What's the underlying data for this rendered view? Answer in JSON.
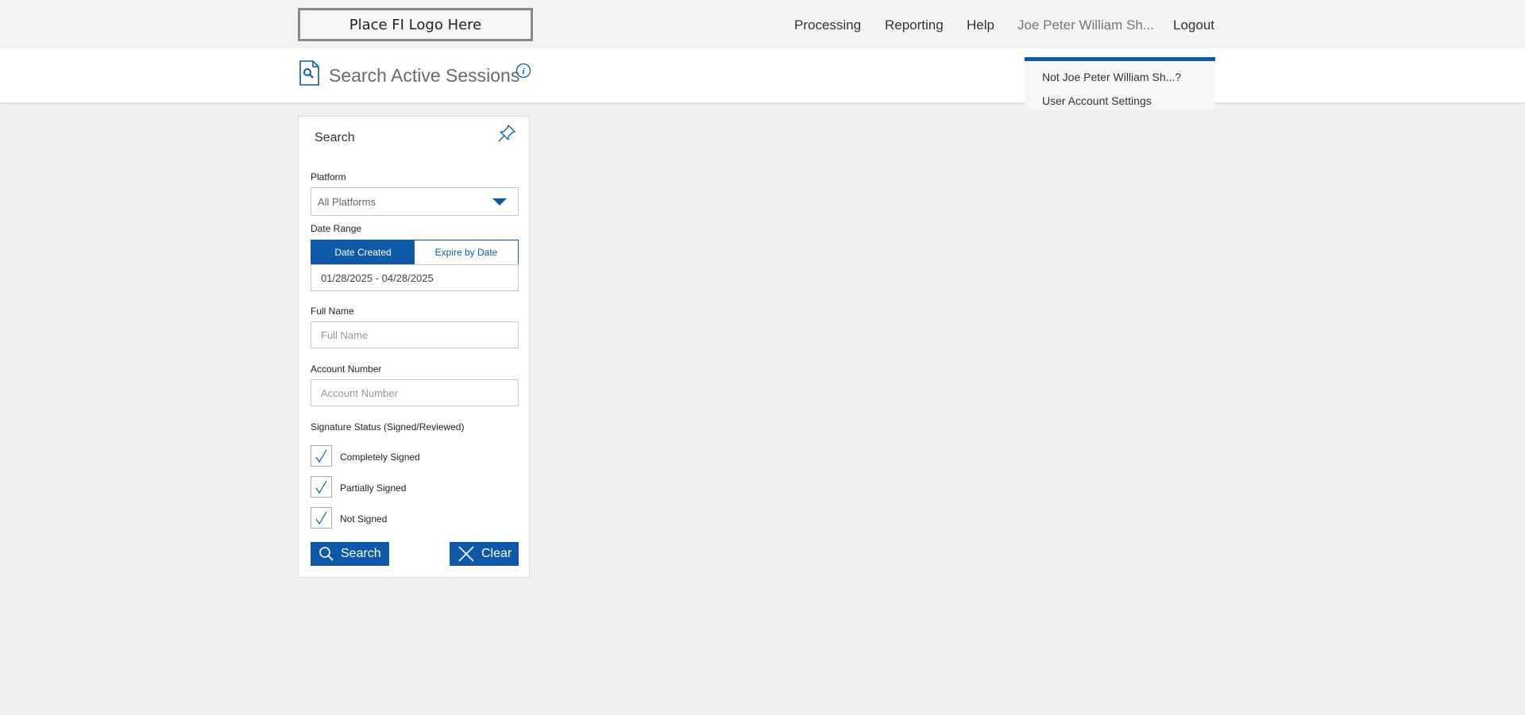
{
  "header": {
    "logo_text": "Place FI Logo Here",
    "nav": {
      "processing": "Processing",
      "reporting": "Reporting",
      "help": "Help",
      "user": "Joe Peter William Sh...",
      "logout": "Logout"
    }
  },
  "page": {
    "title": "Search Active Sessions",
    "title_icon": "search-document-icon",
    "info_icon": "info-icon"
  },
  "user_menu": {
    "items": [
      "Not Joe Peter William Sh...?",
      "User Account Settings"
    ]
  },
  "search_panel": {
    "title": "Search",
    "pin_icon": "pin-icon",
    "platform": {
      "label": "Platform",
      "selected": "All Platforms"
    },
    "date_range": {
      "label": "Date Range",
      "options": [
        "Date Created",
        "Expire by Date"
      ],
      "selected": "Date Created",
      "value": "01/28/2025 - 04/28/2025"
    },
    "full_name": {
      "label": "Full Name",
      "placeholder": "Full Name"
    },
    "account_number": {
      "label": "Account Number",
      "placeholder": "Account Number"
    },
    "signature_status": {
      "label": "Signature Status (Signed/Reviewed)",
      "options": [
        {
          "label": "Completely Signed",
          "checked": true
        },
        {
          "label": "Partially Signed",
          "checked": true
        },
        {
          "label": "Not Signed",
          "checked": true
        }
      ]
    },
    "buttons": {
      "search": "Search",
      "clear": "Clear"
    }
  },
  "colors": {
    "accent": "#0f5aa8",
    "page_bg": "#f0f0f0",
    "topbar_bg": "#f4f4f4"
  }
}
